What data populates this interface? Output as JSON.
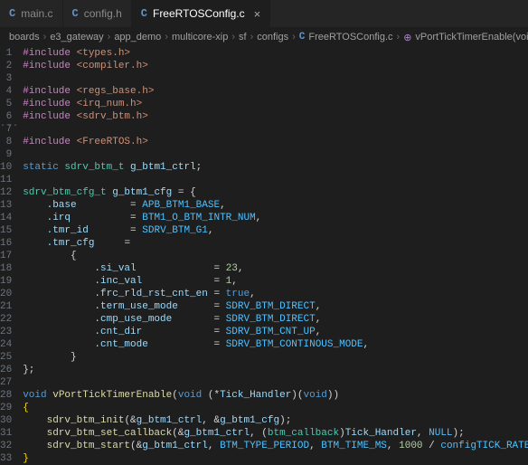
{
  "tabs": [
    {
      "icon": "C",
      "label": "main.c",
      "active": false,
      "close": false
    },
    {
      "icon": "C",
      "label": "config.h",
      "active": false,
      "close": false
    },
    {
      "icon": "C",
      "label": "FreeRTOSConfig.c",
      "active": true,
      "close": true
    }
  ],
  "breadcrumbs": {
    "parts": [
      "boards",
      "e3_gateway",
      "app_demo",
      "multicore-xip",
      "sf",
      "configs"
    ],
    "file": "FreeRTOSConfig.c",
    "symbol": "vPortTickTimerEnable(void(* )(void))",
    "sep": "›"
  },
  "code": {
    "start_line": 1,
    "lines": [
      {
        "pre": "#include",
        "inc": "<types.h>"
      },
      {
        "pre": "#include",
        "inc": "<compiler.h>"
      },
      {
        "blank": true
      },
      {
        "pre": "#include",
        "inc": "<regs_base.h>"
      },
      {
        "pre": "#include",
        "inc": "<irq_num.h>"
      },
      {
        "pre": "#include",
        "inc": "<sdrv_btm.h>"
      },
      {
        "blank": true
      },
      {
        "pre": "#include",
        "inc": "<FreeRTOS.h>"
      },
      {
        "blank": true
      },
      {
        "raw": true,
        "kw": "static",
        "type": "sdrv_btm_t",
        "id": "g_btm1_ctrl",
        "tail": ";"
      },
      {
        "blank": true
      },
      {
        "cfg_head": true,
        "type": "sdrv_btm_cfg_t",
        "id": "g_btm1_cfg"
      },
      {
        "field": ".base",
        "val": "APB_BTM1_BASE",
        "mac": true,
        "comma": true,
        "pad": "        "
      },
      {
        "field": ".irq",
        "val": "BTM1_O_BTM_INTR_NUM",
        "mac": true,
        "comma": true,
        "pad": "         "
      },
      {
        "field": ".tmr_id",
        "val": "SDRV_BTM_G1",
        "mac": true,
        "comma": true,
        "pad": "      "
      },
      {
        "field": ".tmr_cfg",
        "eq_only": true,
        "pad": "     "
      },
      {
        "open_brace": true,
        "indent": "        "
      },
      {
        "field": ".si_val",
        "val": "23",
        "num": true,
        "comma": true,
        "indent": "            ",
        "pad": "            "
      },
      {
        "field": ".inc_val",
        "val": "1",
        "num": true,
        "comma": true,
        "indent": "            ",
        "pad": "           "
      },
      {
        "field": ".frc_rld_rst_cnt_en",
        "val": "true",
        "kw": true,
        "comma": true,
        "indent": "            ",
        "pad": ""
      },
      {
        "field": ".term_use_mode",
        "val": "SDRV_BTM_DIRECT",
        "mac": true,
        "comma": true,
        "indent": "            ",
        "pad": "     "
      },
      {
        "field": ".cmp_use_mode",
        "val": "SDRV_BTM_DIRECT",
        "mac": true,
        "comma": true,
        "indent": "            ",
        "pad": "      "
      },
      {
        "field": ".cnt_dir",
        "val": "SDRV_BTM_CNT_UP",
        "mac": true,
        "comma": true,
        "indent": "            ",
        "pad": "           "
      },
      {
        "field": ".cnt_mode",
        "val": "SDRV_BTM_CONTINOUS_MODE",
        "mac": true,
        "comma": true,
        "indent": "            ",
        "pad": "          "
      },
      {
        "close_brace": true,
        "indent": "        "
      },
      {
        "struct_end": true
      },
      {
        "blank": true
      },
      {
        "func_sig": true,
        "kw": "void",
        "fn": "vPortTickTimerEnable",
        "param_kw": "void",
        "param_id": "Tick_Handler",
        "param_kw2": "void"
      },
      {
        "brace_open_hl": true
      },
      {
        "call3": true,
        "fn": "sdrv_btm_init",
        "a1": "g_btm1_ctrl",
        "a2": "g_btm1_cfg"
      },
      {
        "call_cb": true,
        "fn": "sdrv_btm_set_callback",
        "a1": "g_btm1_ctrl",
        "cast": "btm_callback",
        "a2": "Tick_Handler",
        "a3": "NULL"
      },
      {
        "call_start": true,
        "fn": "sdrv_btm_start",
        "a1": "g_btm1_ctrl",
        "m1": "BTM_TYPE_PERIOD",
        "m2": "BTM_TIME_MS",
        "n": "1000",
        "m3": "configTICK_RATE_HZ"
      },
      {
        "brace_close_hl": true
      }
    ]
  },
  "icons": {
    "fold": "...",
    "fn_symbol": "⊕"
  }
}
